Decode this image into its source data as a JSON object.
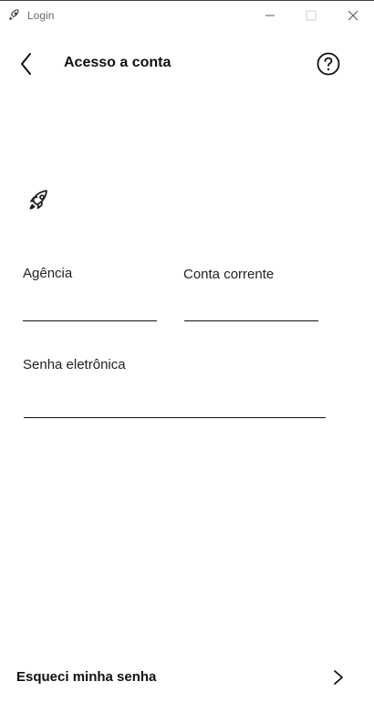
{
  "window": {
    "title": "Login",
    "icons": {
      "app": "rocket-icon",
      "minimize": "minimize-icon",
      "maximize": "maximize-icon",
      "close": "close-icon"
    }
  },
  "header": {
    "title": "Acesso a conta",
    "back_icon": "chevron-left-icon",
    "help_icon": "help-circle-icon"
  },
  "brand": {
    "icon": "rocket-icon"
  },
  "form": {
    "agencia": {
      "label": "Agência",
      "value": ""
    },
    "conta": {
      "label": "Conta corrente",
      "value": ""
    },
    "senha": {
      "label": "Senha eletrônica",
      "value": ""
    }
  },
  "footer": {
    "forgot_label": "Esqueci minha senha",
    "chevron_icon": "chevron-right-icon"
  }
}
